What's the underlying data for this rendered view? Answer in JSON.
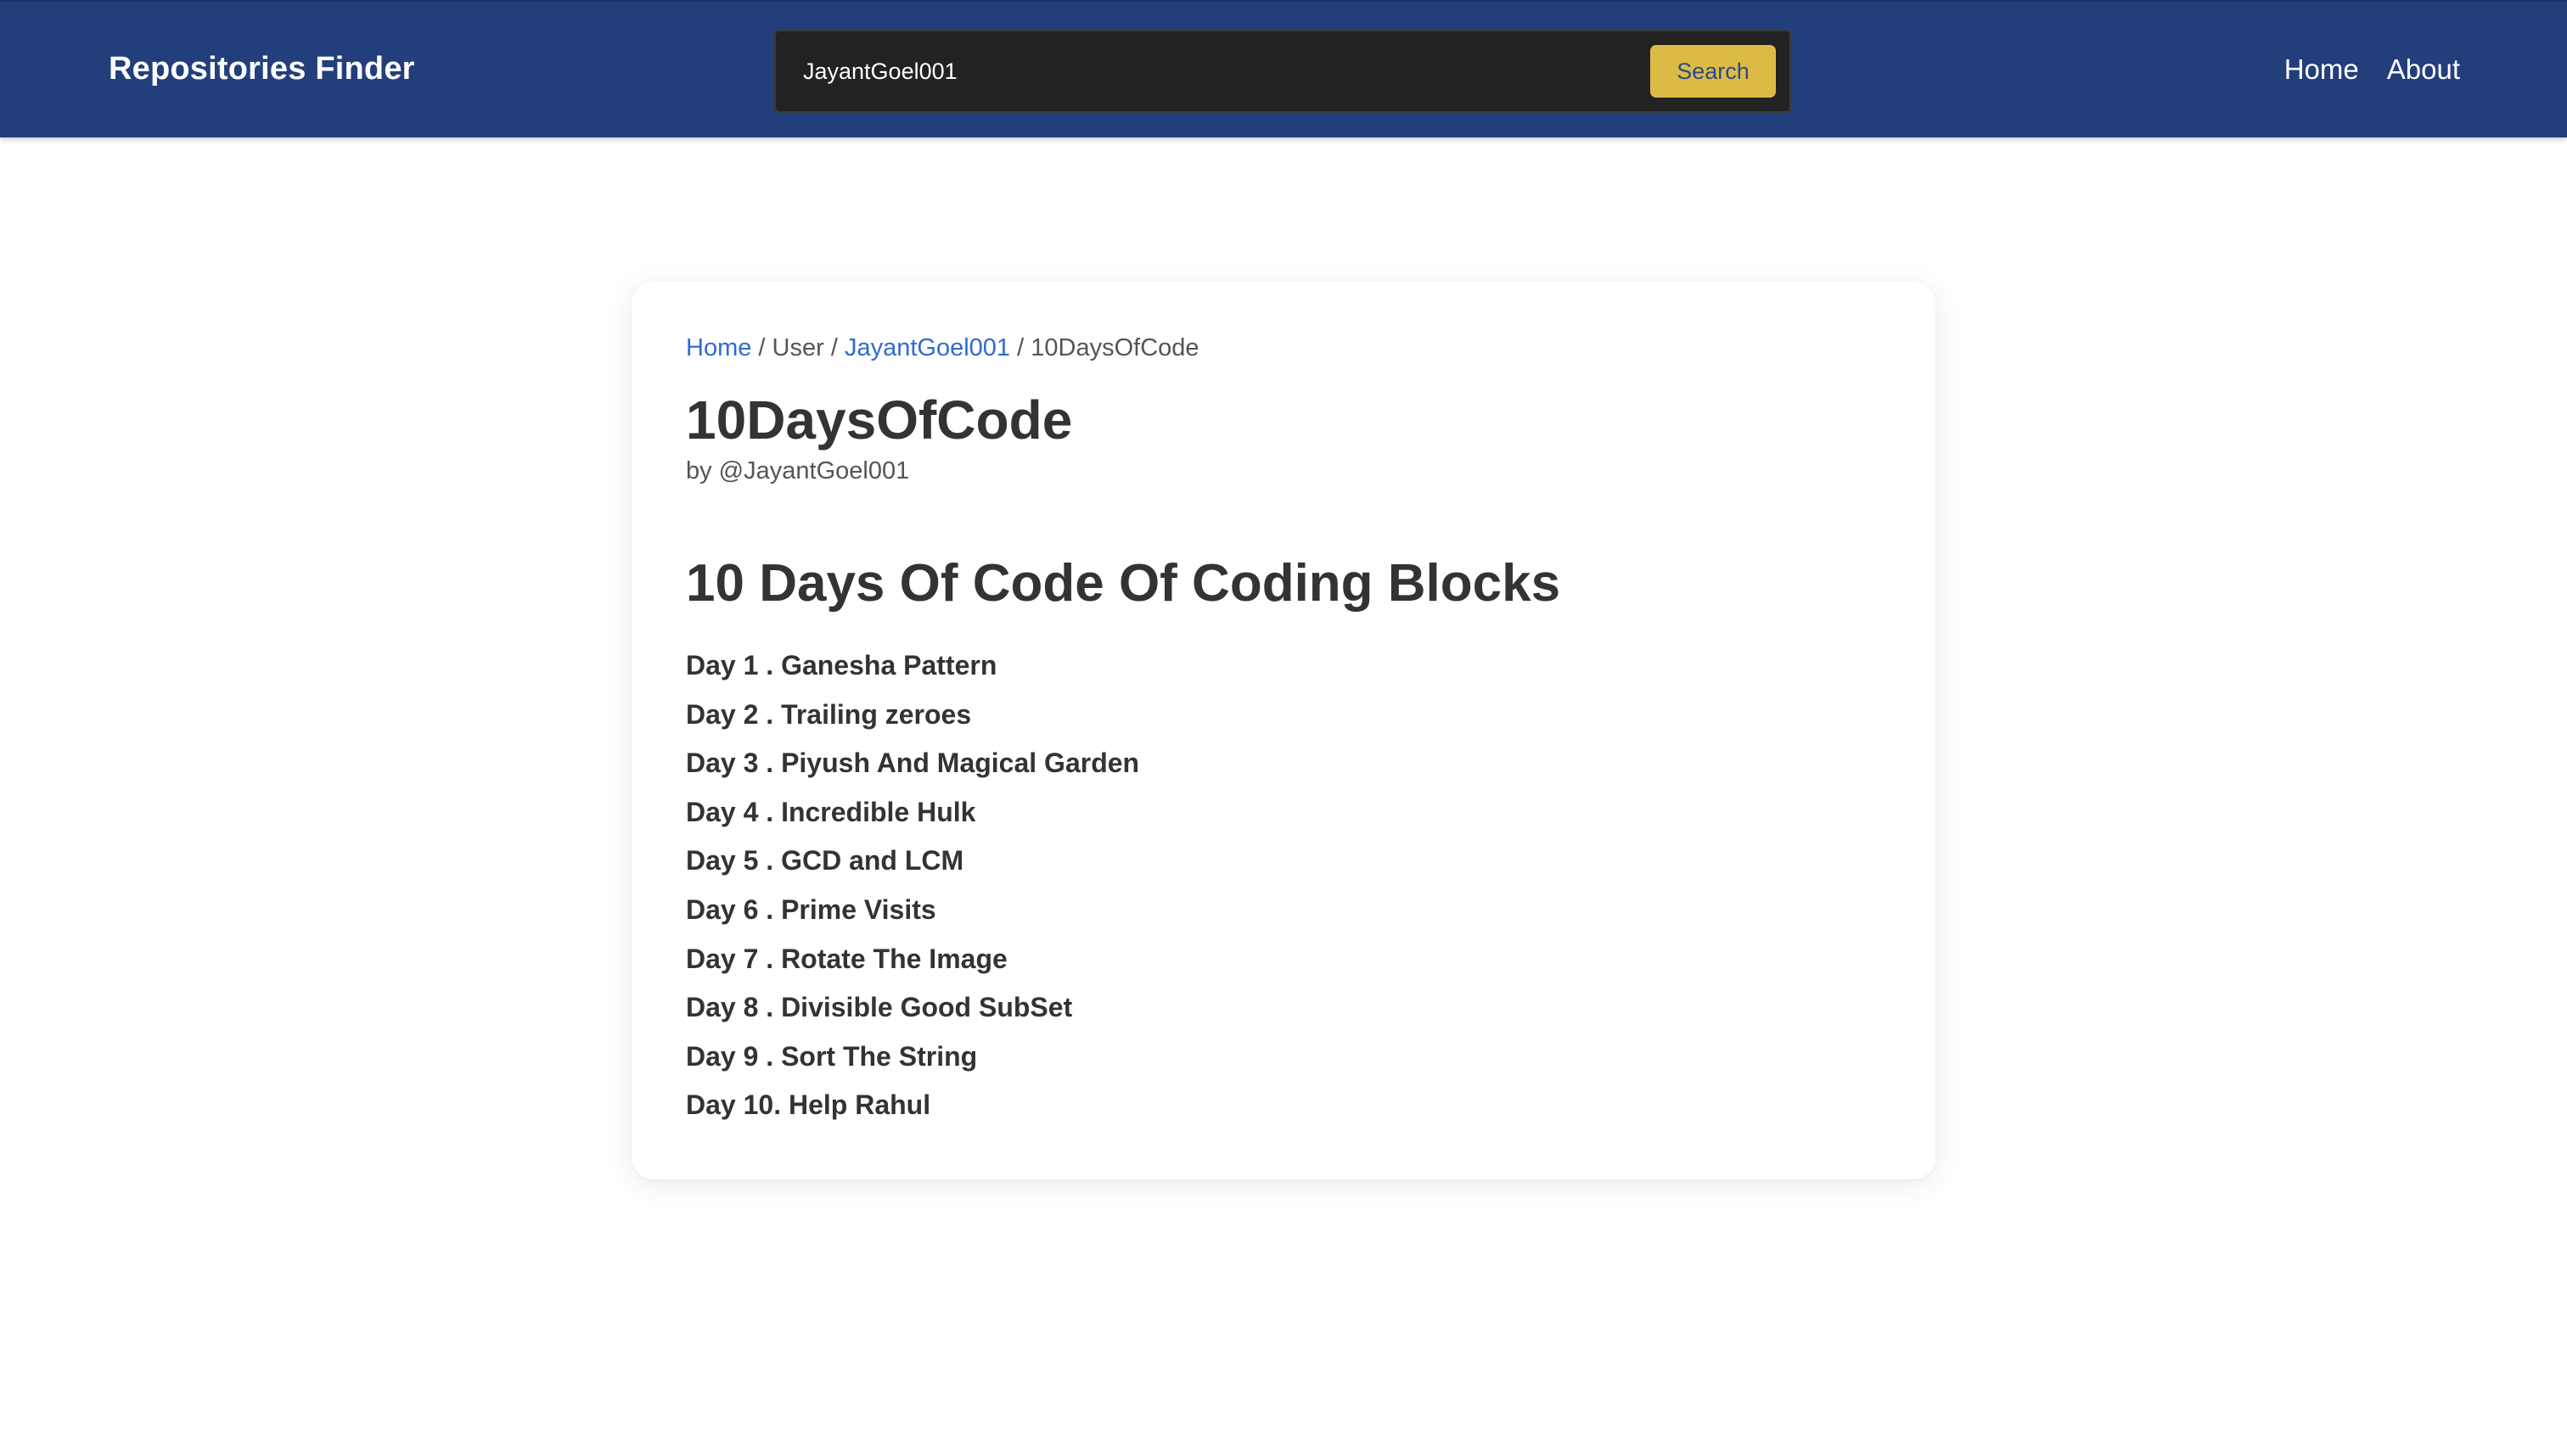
{
  "header": {
    "brand": "Repositories Finder",
    "search": {
      "value": "JayantGoel001",
      "button_label": "Search"
    },
    "nav": [
      "Home",
      "About"
    ]
  },
  "breadcrumb": {
    "home": "Home",
    "sep": "/",
    "user": "User",
    "username": "JayantGoel001",
    "repo": "10DaysOfCode"
  },
  "repo": {
    "title": "10DaysOfCode",
    "owner": "by @JayantGoel001"
  },
  "readme": {
    "heading": "10 Days Of Code Of Coding Blocks",
    "items": [
      "Day 1 . Ganesha Pattern",
      "Day 2 . Trailing zeroes",
      "Day 3 . Piyush And Magical Garden",
      "Day 4 . Incredible Hulk",
      "Day 5 . GCD and LCM",
      "Day 6 . Prime Visits",
      "Day 7 . Rotate The Image",
      "Day 8 . Divisible Good SubSet",
      "Day 9 . Sort The String",
      "Day 10. Help Rahul"
    ]
  },
  "colors": {
    "header_bg": "#223f7c",
    "search_button": "#dcbb45",
    "link": "#2f6bd0"
  }
}
